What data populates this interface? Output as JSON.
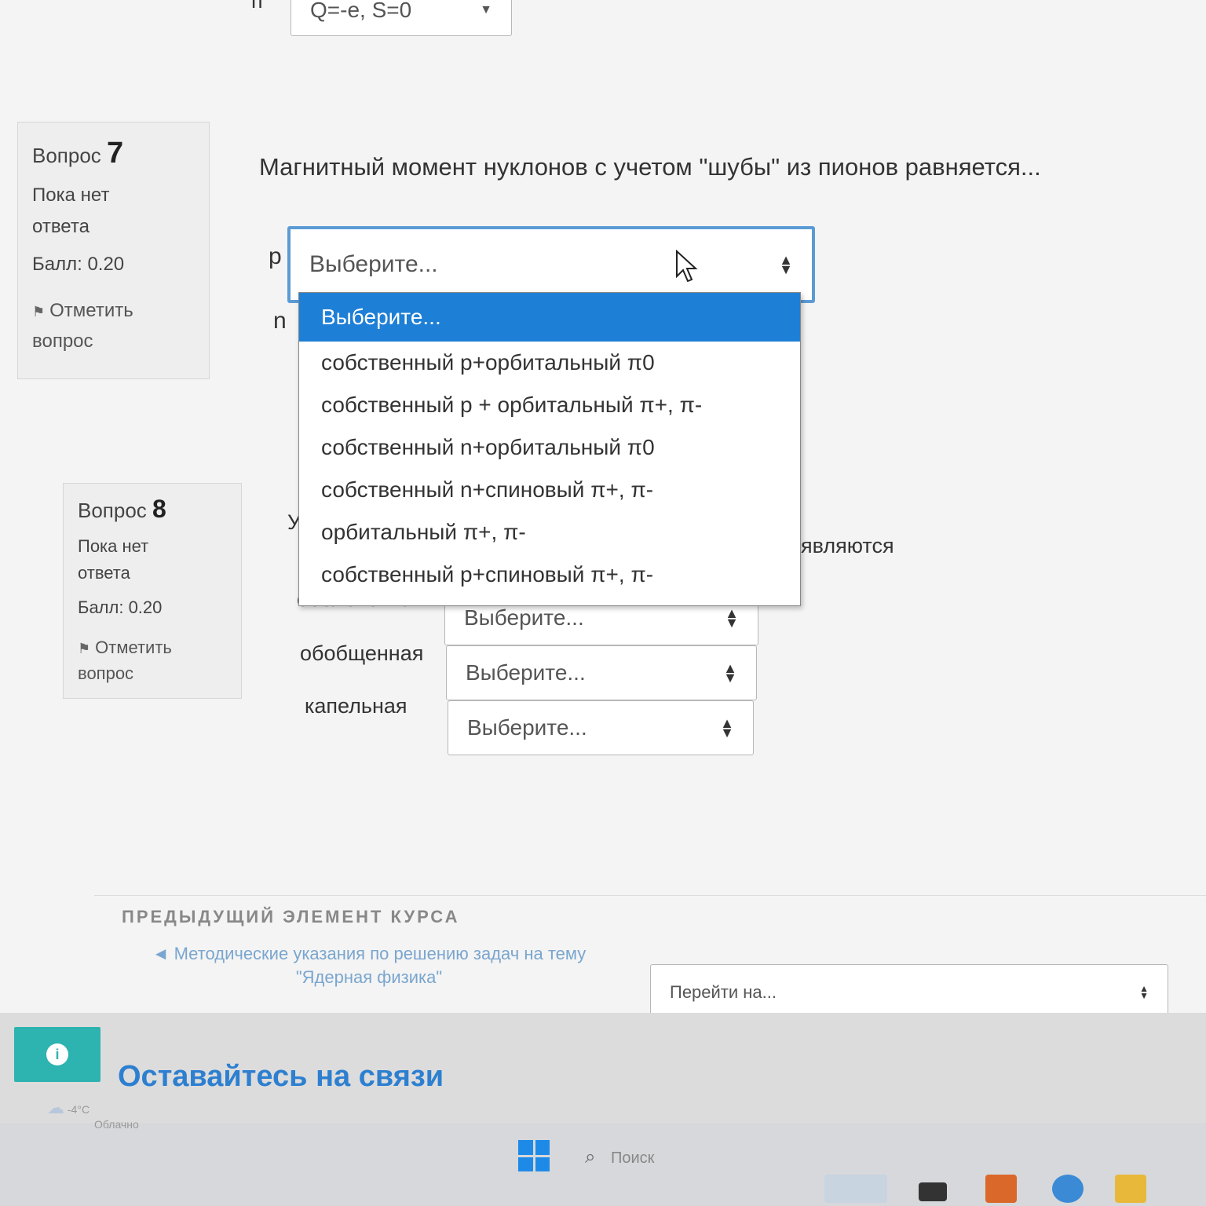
{
  "top_select": {
    "label": "п",
    "value": "Q=-e, S=0"
  },
  "question7": {
    "qno_label": "Вопрос",
    "qno_num": "7",
    "state_line1": "Пока нет",
    "state_line2": "ответа",
    "grade": "Балл: 0.20",
    "flag_line1": "Отметить",
    "flag_line2": "вопрос",
    "text": "Магнитный момент нуклонов с учетом  \"шубы\" из пионов равняется...",
    "rows": [
      {
        "label": "p",
        "value": "Выберите..."
      },
      {
        "label": "n",
        "value": "Выберите..."
      }
    ]
  },
  "dropdown": {
    "options": [
      "Выберите...",
      "собственный p+орбитальный π0",
      "собственный p + орбитальный π+, π-",
      "собственный n+орбитальный π0",
      "собственный n+спиновый π+, π-",
      "орбитальный π+, π-",
      "собственный p+спиновый π+, π-"
    ],
    "selected_index": 0
  },
  "question8": {
    "qno_label": "Вопрос",
    "qno_num": "8",
    "state_line1": "Пока нет",
    "state_line2": "ответа",
    "grade": "Балл: 0.20",
    "flag_line1": "Отметить",
    "flag_line2": "вопрос",
    "text_start": "Уч",
    "text_end": ", являются",
    "rows": [
      {
        "label": "оболочечная",
        "value": "Выберите..."
      },
      {
        "label": "обобщенная",
        "value": "Выберите..."
      },
      {
        "label": "капельная",
        "value": "Выберите..."
      }
    ]
  },
  "footer": {
    "prev_title": "ПРЕДЫДУЩИЙ ЭЛЕМЕНТ КУРСА",
    "prev_link": "◄ Методические указания по решению задач на тему \"Ядерная физика\"",
    "jump_placeholder": "Перейти на..."
  },
  "bottom": {
    "stay_text": "Оставайтесь на связи",
    "info_icon": "i"
  },
  "taskbar": {
    "weather_temp": "-4°C",
    "weather_desc": "Облачно",
    "search_label": "Поиск"
  },
  "colors": {
    "accent": "#1e7fd6",
    "focus_border": "#5b9bd5",
    "teal": "#2db3b0"
  }
}
